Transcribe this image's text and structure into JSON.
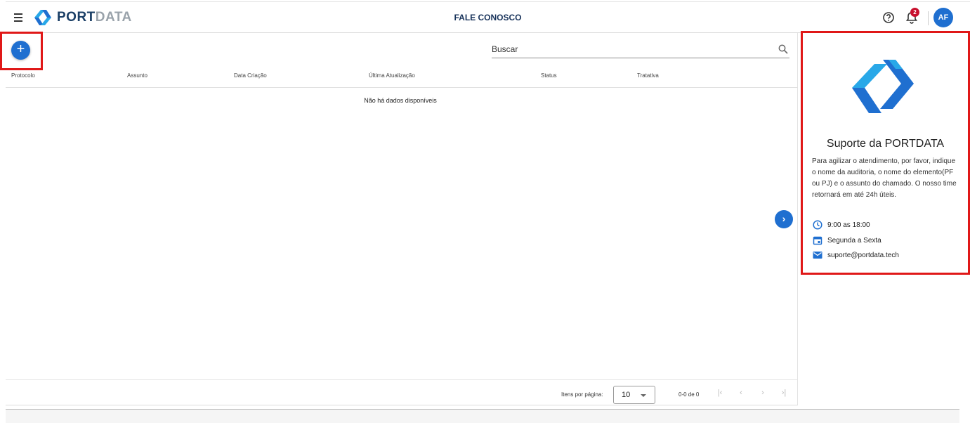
{
  "header": {
    "logo_port": "PORT",
    "logo_data": "DATA",
    "title": "FALE CONOSCO",
    "notifications_count": "2",
    "avatar_initials": "AF"
  },
  "toolbar": {
    "add_label": "+",
    "search_placeholder": "Buscar"
  },
  "table": {
    "columns": [
      "Protocolo",
      "Assunto",
      "Data Criação",
      "Última Atualização",
      "Status",
      "Tratativa"
    ],
    "empty_message": "Não há dados disponíveis"
  },
  "paginator": {
    "items_per_page_label": "Itens por página:",
    "page_size": "10",
    "range_label": "0-0 de 0"
  },
  "support": {
    "title": "Suporte da PORTDATA",
    "description": "Para agilizar o atendimento, por favor, indique o nome da auditoria, o nome do elemento(PF ou PJ) e o assunto do chamado. O nosso time retornará em até 24h úteis.",
    "hours": "9:00 as 18:00",
    "days": "Segunda a Sexta",
    "email": "suporte@portdata.tech"
  },
  "colors": {
    "primary": "#1f6fd0",
    "brand_dark": "#1b3f66",
    "brand_light": "#29a8e8",
    "highlight": "#e01818",
    "badge": "#c8102e"
  },
  "icons": [
    "menu-icon",
    "help-icon",
    "bell-icon",
    "search-icon",
    "chevron-right-icon",
    "clock-icon",
    "calendar-icon",
    "mail-icon"
  ]
}
